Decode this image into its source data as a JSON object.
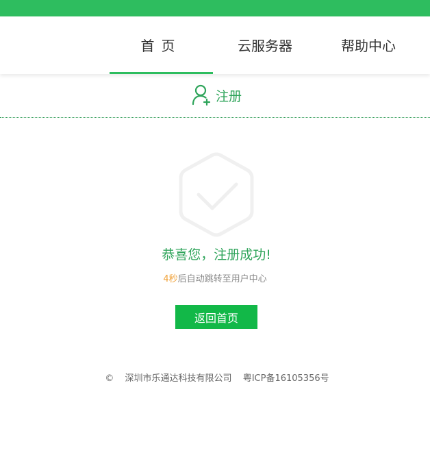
{
  "nav": {
    "items": [
      {
        "label": "首页"
      },
      {
        "label": "云服务器"
      },
      {
        "label": "帮助中心"
      }
    ]
  },
  "register": {
    "label": "注册"
  },
  "success": {
    "title": "恭喜您，注册成功!",
    "countdown": "4秒",
    "redirect_text": "后自动跳转至用户中心",
    "button_label": "返回首页"
  },
  "footer": {
    "copyright_symbol": "©",
    "company": "深圳市乐通达科技有限公司",
    "icp": "粤ICP备16105356号"
  },
  "colors": {
    "brand_green": "#2ebd5f",
    "button_green": "#12b848",
    "countdown_orange": "#f0a23a"
  },
  "icons": {
    "user_add": "user-add-icon",
    "success_check": "hexagon-check-icon"
  }
}
